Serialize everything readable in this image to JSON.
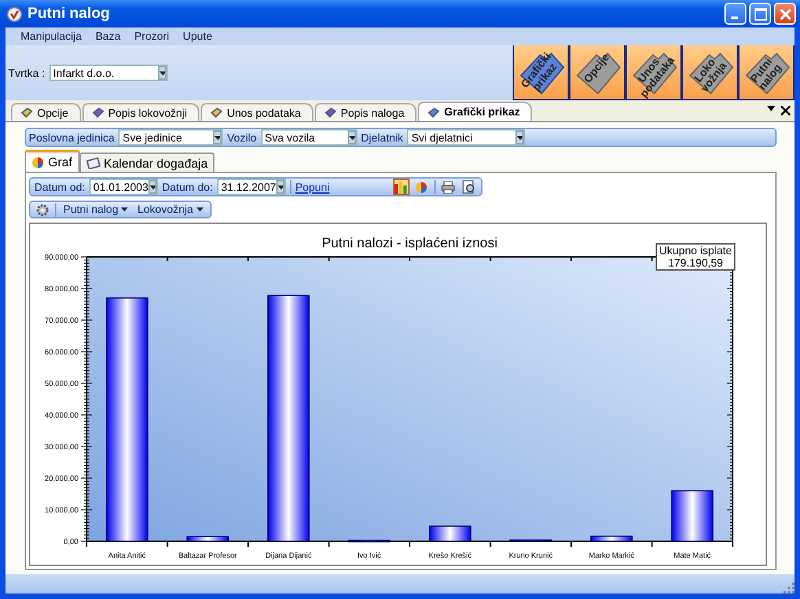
{
  "window": {
    "title": "Putni nalog"
  },
  "menu": [
    "Manipulacija",
    "Baza",
    "Prozori",
    "Upute"
  ],
  "company": {
    "label": "Tvrtka :",
    "value": "Infarkt d.o.o."
  },
  "quick_buttons": [
    {
      "label": "Grafički prikaz",
      "selected": true
    },
    {
      "label": "Opcije",
      "selected": false
    },
    {
      "label": "Unos podataka",
      "selected": false
    },
    {
      "label": "Loko vožnja",
      "selected": false
    },
    {
      "label": "Putni nalog",
      "selected": false
    }
  ],
  "tabs": [
    {
      "label": "Opcije",
      "selected": false
    },
    {
      "label": "Popis lokovožnji",
      "selected": false
    },
    {
      "label": "Unos podataka",
      "selected": false
    },
    {
      "label": "Popis naloga",
      "selected": false
    },
    {
      "label": "Grafički prikaz",
      "selected": true
    }
  ],
  "filters": [
    {
      "label": "Poslovna jedinica",
      "value": "Sve jedinice"
    },
    {
      "label": "Vozilo",
      "value": "Sva vozila"
    },
    {
      "label": "Djelatnik",
      "value": "Svi djelatnici"
    }
  ],
  "view_tabs": [
    {
      "label": "Graf",
      "kind": "chart",
      "selected": true
    },
    {
      "label": "Kalendar događaja",
      "kind": "calendar",
      "selected": false
    }
  ],
  "date_from": {
    "label": "Datum od:",
    "value": "01.01.2003"
  },
  "date_to": {
    "label": "Datum do:",
    "value": "31.12.2007"
  },
  "fill_link": "Popuni",
  "chart_type_buttons": [
    {
      "kind": "bar",
      "selected": true
    },
    {
      "kind": "pie",
      "selected": false
    }
  ],
  "menu_buttons": [
    "Putni nalog",
    "Lokovožnja"
  ],
  "chart": {
    "total_label": "Ukupno isplate",
    "total_value": "179.190,59",
    "chart_data": {
      "type": "bar",
      "title": "Putni nalozi - isplaćeni iznosi",
      "categories": [
        "Anita Anitić",
        "Baltazar Profesor",
        "Dijana Dijanić",
        "Ivo Ivić",
        "Krešo Krešić",
        "Kruno Krunić",
        "Marko Markić",
        "Mate Matić"
      ],
      "values": [
        77000,
        1500,
        77800,
        300,
        4800,
        400,
        1600,
        16000
      ],
      "ylim": [
        0,
        90000
      ],
      "yticks": [
        {
          "value": 0,
          "label": "0,00"
        },
        {
          "value": 10000,
          "label": "10.000,00"
        },
        {
          "value": 20000,
          "label": "20.000,00"
        },
        {
          "value": 30000,
          "label": "30.000,00"
        },
        {
          "value": 40000,
          "label": "40.000,00"
        },
        {
          "value": 50000,
          "label": "50.000,00"
        },
        {
          "value": 60000,
          "label": "60.000,00"
        },
        {
          "value": 70000,
          "label": "70.000,00"
        },
        {
          "value": 80000,
          "label": "80.000,00"
        },
        {
          "value": 90000,
          "label": "90.000,00"
        }
      ]
    }
  }
}
